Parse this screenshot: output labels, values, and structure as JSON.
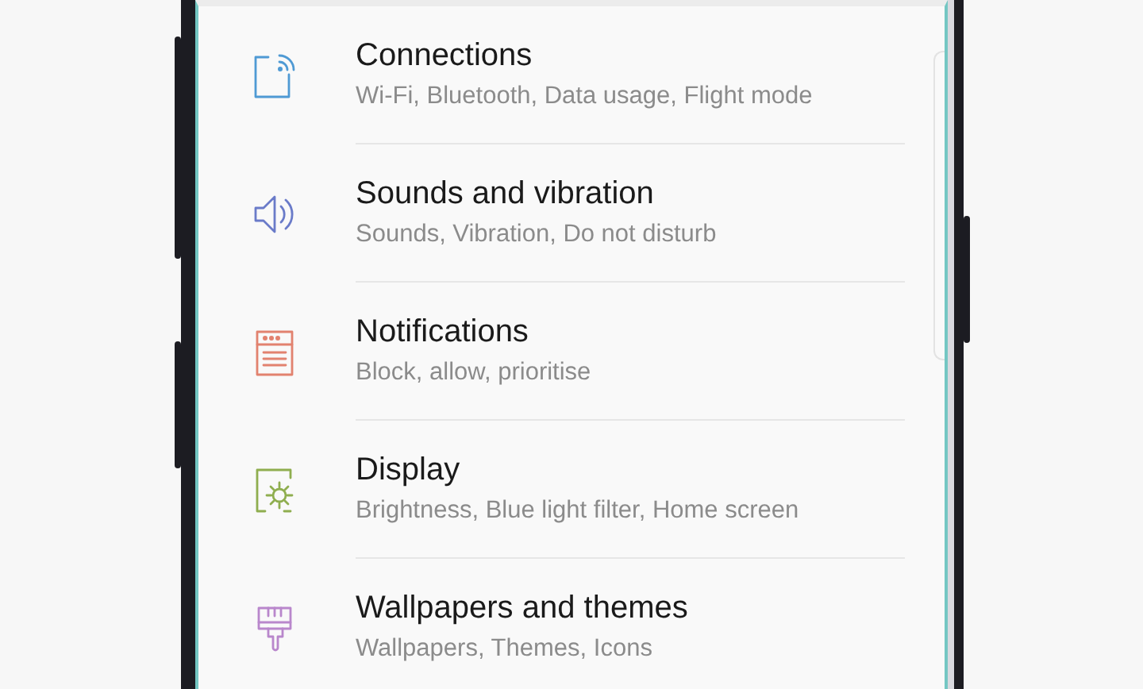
{
  "settings": [
    {
      "kind": "connections",
      "color": "#4f9ad4",
      "title": "Connections",
      "subtitle": "Wi-Fi, Bluetooth, Data usage, Flight mode"
    },
    {
      "kind": "sound",
      "color": "#6a7bc9",
      "title": "Sounds and vibration",
      "subtitle": "Sounds, Vibration, Do not disturb"
    },
    {
      "kind": "notifications",
      "color": "#e2826f",
      "title": "Notifications",
      "subtitle": "Block, allow, prioritise"
    },
    {
      "kind": "display",
      "color": "#8fae4f",
      "title": "Display",
      "subtitle": "Brightness, Blue light filter, Home screen"
    },
    {
      "kind": "wallpaper",
      "color": "#b987cc",
      "title": "Wallpapers and themes",
      "subtitle": "Wallpapers, Themes, Icons"
    }
  ]
}
